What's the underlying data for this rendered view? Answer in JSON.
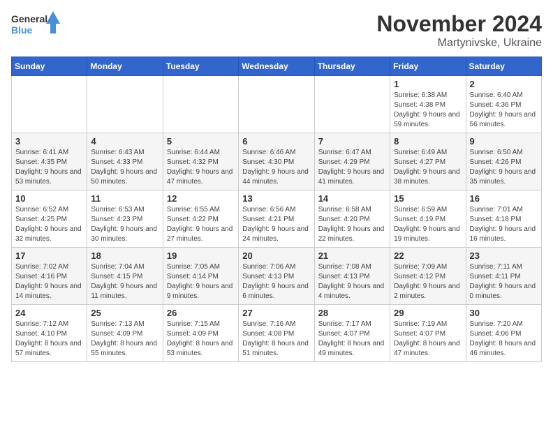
{
  "logo": {
    "line1": "General",
    "line2": "Blue"
  },
  "title": "November 2024",
  "location": "Martynivske, Ukraine",
  "days_of_week": [
    "Sunday",
    "Monday",
    "Tuesday",
    "Wednesday",
    "Thursday",
    "Friday",
    "Saturday"
  ],
  "weeks": [
    [
      {
        "day": "",
        "info": ""
      },
      {
        "day": "",
        "info": ""
      },
      {
        "day": "",
        "info": ""
      },
      {
        "day": "",
        "info": ""
      },
      {
        "day": "",
        "info": ""
      },
      {
        "day": "1",
        "info": "Sunrise: 6:38 AM\nSunset: 4:38 PM\nDaylight: 9 hours and 59 minutes."
      },
      {
        "day": "2",
        "info": "Sunrise: 6:40 AM\nSunset: 4:36 PM\nDaylight: 9 hours and 56 minutes."
      }
    ],
    [
      {
        "day": "3",
        "info": "Sunrise: 6:41 AM\nSunset: 4:35 PM\nDaylight: 9 hours and 53 minutes."
      },
      {
        "day": "4",
        "info": "Sunrise: 6:43 AM\nSunset: 4:33 PM\nDaylight: 9 hours and 50 minutes."
      },
      {
        "day": "5",
        "info": "Sunrise: 6:44 AM\nSunset: 4:32 PM\nDaylight: 9 hours and 47 minutes."
      },
      {
        "day": "6",
        "info": "Sunrise: 6:46 AM\nSunset: 4:30 PM\nDaylight: 9 hours and 44 minutes."
      },
      {
        "day": "7",
        "info": "Sunrise: 6:47 AM\nSunset: 4:29 PM\nDaylight: 9 hours and 41 minutes."
      },
      {
        "day": "8",
        "info": "Sunrise: 6:49 AM\nSunset: 4:27 PM\nDaylight: 9 hours and 38 minutes."
      },
      {
        "day": "9",
        "info": "Sunrise: 6:50 AM\nSunset: 4:26 PM\nDaylight: 9 hours and 35 minutes."
      }
    ],
    [
      {
        "day": "10",
        "info": "Sunrise: 6:52 AM\nSunset: 4:25 PM\nDaylight: 9 hours and 32 minutes."
      },
      {
        "day": "11",
        "info": "Sunrise: 6:53 AM\nSunset: 4:23 PM\nDaylight: 9 hours and 30 minutes."
      },
      {
        "day": "12",
        "info": "Sunrise: 6:55 AM\nSunset: 4:22 PM\nDaylight: 9 hours and 27 minutes."
      },
      {
        "day": "13",
        "info": "Sunrise: 6:56 AM\nSunset: 4:21 PM\nDaylight: 9 hours and 24 minutes."
      },
      {
        "day": "14",
        "info": "Sunrise: 6:58 AM\nSunset: 4:20 PM\nDaylight: 9 hours and 22 minutes."
      },
      {
        "day": "15",
        "info": "Sunrise: 6:59 AM\nSunset: 4:19 PM\nDaylight: 9 hours and 19 minutes."
      },
      {
        "day": "16",
        "info": "Sunrise: 7:01 AM\nSunset: 4:18 PM\nDaylight: 9 hours and 16 minutes."
      }
    ],
    [
      {
        "day": "17",
        "info": "Sunrise: 7:02 AM\nSunset: 4:16 PM\nDaylight: 9 hours and 14 minutes."
      },
      {
        "day": "18",
        "info": "Sunrise: 7:04 AM\nSunset: 4:15 PM\nDaylight: 9 hours and 11 minutes."
      },
      {
        "day": "19",
        "info": "Sunrise: 7:05 AM\nSunset: 4:14 PM\nDaylight: 9 hours and 9 minutes."
      },
      {
        "day": "20",
        "info": "Sunrise: 7:06 AM\nSunset: 4:13 PM\nDaylight: 9 hours and 6 minutes."
      },
      {
        "day": "21",
        "info": "Sunrise: 7:08 AM\nSunset: 4:13 PM\nDaylight: 9 hours and 4 minutes."
      },
      {
        "day": "22",
        "info": "Sunrise: 7:09 AM\nSunset: 4:12 PM\nDaylight: 9 hours and 2 minutes."
      },
      {
        "day": "23",
        "info": "Sunrise: 7:11 AM\nSunset: 4:11 PM\nDaylight: 9 hours and 0 minutes."
      }
    ],
    [
      {
        "day": "24",
        "info": "Sunrise: 7:12 AM\nSunset: 4:10 PM\nDaylight: 8 hours and 57 minutes."
      },
      {
        "day": "25",
        "info": "Sunrise: 7:13 AM\nSunset: 4:09 PM\nDaylight: 8 hours and 55 minutes."
      },
      {
        "day": "26",
        "info": "Sunrise: 7:15 AM\nSunset: 4:09 PM\nDaylight: 8 hours and 53 minutes."
      },
      {
        "day": "27",
        "info": "Sunrise: 7:16 AM\nSunset: 4:08 PM\nDaylight: 8 hours and 51 minutes."
      },
      {
        "day": "28",
        "info": "Sunrise: 7:17 AM\nSunset: 4:07 PM\nDaylight: 8 hours and 49 minutes."
      },
      {
        "day": "29",
        "info": "Sunrise: 7:19 AM\nSunset: 4:07 PM\nDaylight: 8 hours and 47 minutes."
      },
      {
        "day": "30",
        "info": "Sunrise: 7:20 AM\nSunset: 4:06 PM\nDaylight: 8 hours and 46 minutes."
      }
    ]
  ]
}
